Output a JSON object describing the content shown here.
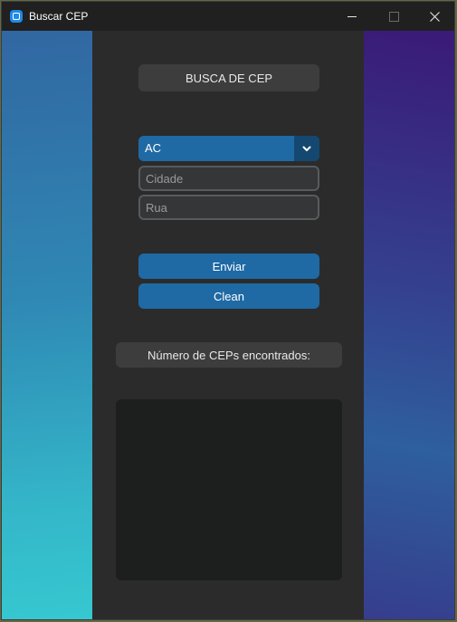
{
  "window": {
    "title": "Buscar CEP",
    "icon": "app-icon"
  },
  "controls": {
    "minimize": "minimize-icon",
    "maximize": "maximize-icon",
    "close": "close-icon"
  },
  "form": {
    "header": "BUSCA DE CEP",
    "state_select": {
      "value": "AC"
    },
    "city": {
      "value": "",
      "placeholder": "Cidade"
    },
    "street": {
      "value": "",
      "placeholder": "Rua"
    },
    "send_label": "Enviar",
    "clean_label": "Clean",
    "count_label": "Número de CEPs encontrados:"
  },
  "colors": {
    "accent": "#1f6aa5",
    "accent_dark": "#144870",
    "panel": "#2b2b2b",
    "field_bg": "#343638",
    "label_bg": "#3d3d3d",
    "results_bg": "#1d1e1e"
  }
}
